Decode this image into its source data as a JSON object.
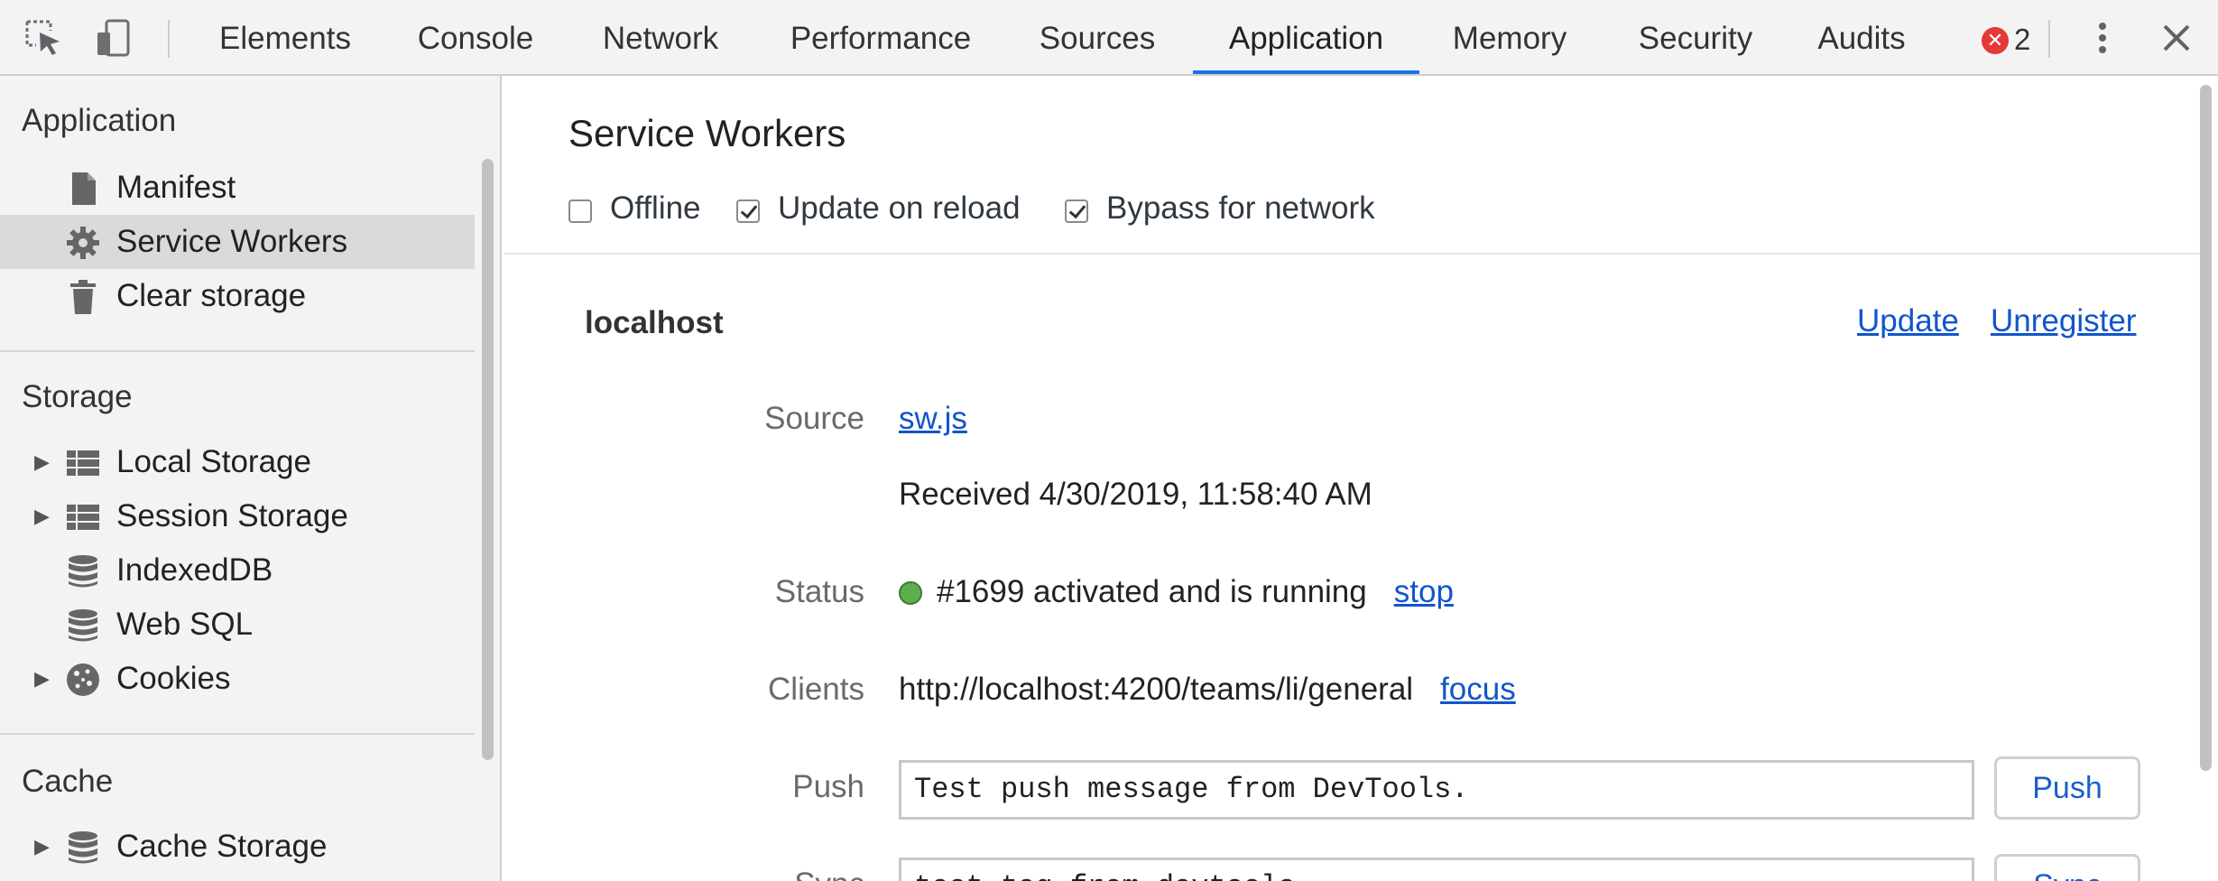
{
  "toolbar": {
    "tabs": [
      {
        "label": "Elements"
      },
      {
        "label": "Console"
      },
      {
        "label": "Network"
      },
      {
        "label": "Performance"
      },
      {
        "label": "Sources"
      },
      {
        "label": "Application"
      },
      {
        "label": "Memory"
      },
      {
        "label": "Security"
      },
      {
        "label": "Audits"
      }
    ],
    "active_tab": "Application",
    "error_count": "2",
    "icons": [
      "inspect-element-icon",
      "device-toolbar-icon",
      "error-icon",
      "kebab-menu-icon",
      "close-icon"
    ],
    "accent_color": "#1a73e8"
  },
  "sidebar": {
    "sections": [
      {
        "title": "Application",
        "items": [
          {
            "label": "Manifest",
            "icon": "file-icon"
          },
          {
            "label": "Service Workers",
            "icon": "gear-icon",
            "selected": true
          },
          {
            "label": "Clear storage",
            "icon": "trash-icon"
          }
        ]
      },
      {
        "title": "Storage",
        "items": [
          {
            "label": "Local Storage",
            "icon": "grid-icon",
            "expandable": true
          },
          {
            "label": "Session Storage",
            "icon": "grid-icon",
            "expandable": true
          },
          {
            "label": "IndexedDB",
            "icon": "database-icon"
          },
          {
            "label": "Web SQL",
            "icon": "database-icon"
          },
          {
            "label": "Cookies",
            "icon": "cookie-icon",
            "expandable": true
          }
        ]
      },
      {
        "title": "Cache",
        "items": [
          {
            "label": "Cache Storage",
            "icon": "database-icon",
            "expandable": true
          }
        ]
      }
    ]
  },
  "main": {
    "title": "Service Workers",
    "options": [
      {
        "label": "Offline",
        "checked": false
      },
      {
        "label": "Update on reload",
        "checked": true
      },
      {
        "label": "Bypass for network",
        "checked": true
      }
    ],
    "host": "localhost",
    "update_link": "Update",
    "unregister_link": "Unregister",
    "source_label": "Source",
    "source_link": "sw.js",
    "received": "Received 4/30/2019, 11:58:40 AM",
    "status_label": "Status",
    "status_text": "#1699 activated and is running",
    "status_link": "stop",
    "status_color": "#5fae4e",
    "clients_label": "Clients",
    "clients_url": "http://localhost:4200/teams/li/general",
    "clients_link": "focus",
    "push_label": "Push",
    "push_value": "Test push message from DevTools.",
    "push_button": "Push",
    "sync_label": "Sync",
    "sync_value": "test-tag-from-devtools",
    "sync_button": "Sync"
  }
}
